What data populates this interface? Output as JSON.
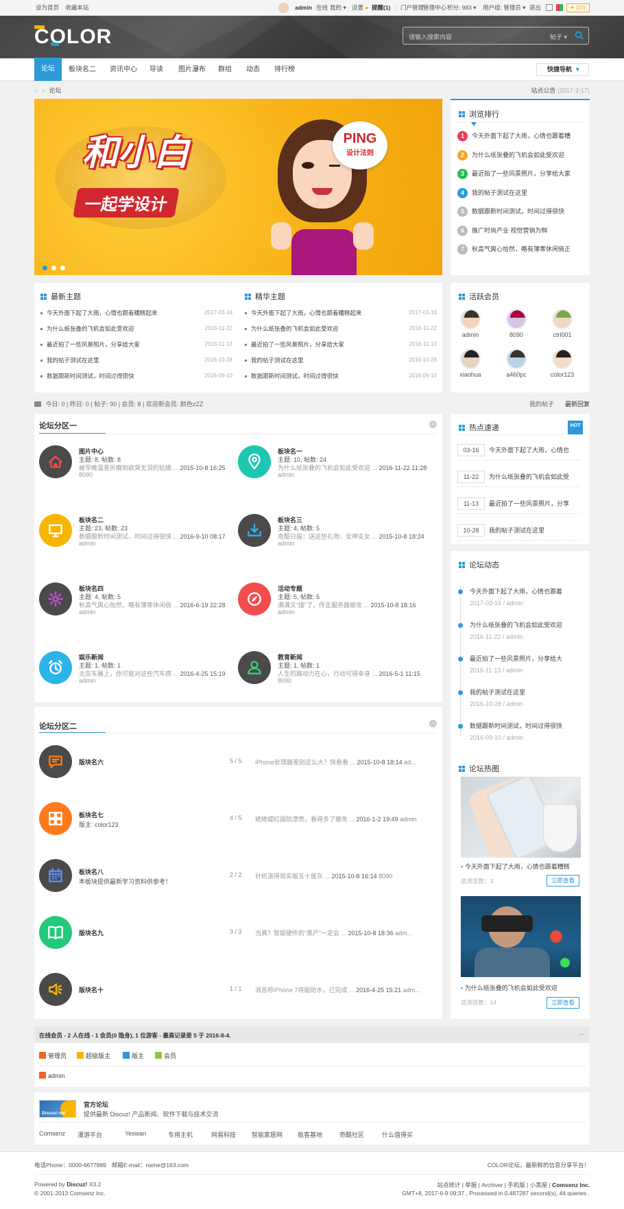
{
  "topbar": {
    "left_links": [
      "设为首页",
      "收藏本站"
    ],
    "username": "admin",
    "online": "在线",
    "items": [
      "我的",
      "设置"
    ],
    "remind": "提醒(1)",
    "right_items": [
      "门户管理",
      "管理中心",
      "积分: 983",
      "用户组: 管理员",
      "退出"
    ],
    "diy": "DIY"
  },
  "header": {
    "logo": "COLOR",
    "search_placeholder": "请输入搜索内容",
    "search_type": "帖子"
  },
  "nav": {
    "items": [
      "论坛",
      "板块名二",
      "资讯中心",
      "导读",
      "图片瀑布",
      "群组",
      "动态",
      "排行榜"
    ],
    "quick_nav": "快捷导航"
  },
  "breadcrumb": {
    "current": "论坛",
    "notice": "站点公告",
    "notice_date": "(2017-2-17)"
  },
  "banner": {
    "main_text": "和小白",
    "sub_text": "一起学设计",
    "bubble_title": "PING",
    "bubble_sub": "设计法则"
  },
  "browse_rank": {
    "title": "浏览排行",
    "items": [
      {
        "n": "1",
        "text": "今天外面下起了大雨，心情也跟着糟",
        "color": "#e83e5a"
      },
      {
        "n": "2",
        "text": "为什么纸张叠的飞机会如此受欢迎",
        "color": "#f5a623"
      },
      {
        "n": "3",
        "text": "最近拍了一些风景照片，分享给大家",
        "color": "#2dba5e"
      },
      {
        "n": "4",
        "text": "我的帖子测试在这里",
        "color": "#2c99d8"
      },
      {
        "n": "5",
        "text": "数据跟新时间测试，时间过得很快",
        "color": "#bbbbbb"
      },
      {
        "n": "6",
        "text": "推广时尚产业 视觉营销为鲜",
        "color": "#bbbbbb"
      },
      {
        "n": "7",
        "text": "秋高气爽心怡然，略有薄寒休闲倘正",
        "color": "#bbbbbb"
      }
    ]
  },
  "latest": {
    "title": "最新主题",
    "items": [
      {
        "text": "今天外面下起了大雨，心情也跟着糟糕起来",
        "date": "2017-03-16"
      },
      {
        "text": "为什么纸张叠的飞机会如此受欢迎",
        "date": "2016-11-22"
      },
      {
        "text": "最近拍了一些风景照片，分享给大家",
        "date": "2016-11-13"
      },
      {
        "text": "我的帖子测试在这里",
        "date": "2016-10-28"
      },
      {
        "text": "数据跟新时间测试，时间过得很快",
        "date": "2016-09-10"
      }
    ]
  },
  "digest": {
    "title": "精华主题",
    "items": [
      {
        "text": "今天外面下起了大雨，心情也跟着糟糕起来",
        "date": "2017-03-16"
      },
      {
        "text": "为什么纸张叠的飞机会如此受欢迎",
        "date": "2016-11-22"
      },
      {
        "text": "最近拍了一些风景照片，分享给大家",
        "date": "2016-11-13"
      },
      {
        "text": "我的帖子测试在这里",
        "date": "2016-10-28"
      },
      {
        "text": "数据跟新时间测试，时间过得很快",
        "date": "2016-09-10"
      }
    ]
  },
  "active_members": {
    "title": "活跃会员",
    "members": [
      "admin",
      "8090",
      "ctrl001",
      "xiaohua",
      "a460pc",
      "color123"
    ]
  },
  "stats": {
    "text": "今日: 0 | 昨日: 0 | 帖子: 90 | 会员: 8 | 欢迎新会员: 颜色zZZ",
    "my_posts": "我的帖子",
    "latest_reply": "最新回复"
  },
  "area1": {
    "title": "论坛分区一",
    "forums": [
      {
        "name": "图片中心",
        "stat": "主题: 8, 帖数: 8",
        "last": "被早晚温差折磨到欲哭无泪的姑娘 ...",
        "time": "2015-10-8 16:25",
        "author": "8090",
        "color": "#4a4a4a",
        "icon": "home"
      },
      {
        "name": "板块名一",
        "stat": "主题: 10, 帖数: 24",
        "last": "为什么纸张叠的飞机会如此受欢迎 ...",
        "time": "2016-11-22 11:28",
        "author": "admin",
        "color": "#1ec8b0",
        "icon": "pin"
      },
      {
        "name": "板块名二",
        "stat": "主题: 23, 帖数: 23",
        "last": "数据跟新时间测试，时间过得很快 ...",
        "time": "2016-9-10 08:17",
        "author": "admin",
        "color": "#f7b500",
        "icon": "monitor"
      },
      {
        "name": "板块名三",
        "stat": "主题: 4, 帖数: 5",
        "last": "奇酷日报：送这些礼物，女神支女 ...",
        "time": "2015-10-8 18:24",
        "author": "admin",
        "color": "#4a4a4a",
        "icon": "download"
      },
      {
        "name": "板块名四",
        "stat": "主题: 4, 帖数: 5",
        "last": "秋高气爽心怡然，略有薄寒休闲倘 ...",
        "time": "2016-6-19 22:28",
        "author": "admin",
        "color": "#4a4a4a",
        "icon": "gear"
      },
      {
        "name": "活动专题",
        "stat": "主题: 5, 帖数: 5",
        "last": "满满又“接”了，传言服务器被攻 ...",
        "time": "2015-10-8 18:16",
        "author": "admin",
        "color": "#f24c4c",
        "icon": "compass"
      },
      {
        "name": "娱乐新闻",
        "stat": "主题: 1, 帖数: 1",
        "last": "北京车展上，你可能对这些汽车感 ...",
        "time": "2016-4-25 15:19",
        "author": "admin",
        "color": "#2cb3e8",
        "icon": "alarm"
      },
      {
        "name": "教育新闻",
        "stat": "主题: 1, 帖数: 1",
        "last": "人生的路动力在心，行动可得幸身 ...",
        "time": "2016-5-1 11:15",
        "author": "8090",
        "color": "#4a4a4a",
        "icon": "user"
      }
    ]
  },
  "area2": {
    "title": "论坛分区二",
    "forums": [
      {
        "name": "版块名六",
        "desc": "",
        "count": "5 / 5",
        "last": "iPhone处理器差别这么大？快看看 ...",
        "time": "2015-10-8 18:14",
        "author": "ad...",
        "color": "#4a4a4a",
        "icon": "chat"
      },
      {
        "name": "板块名七",
        "desc": "版主: color123",
        "count": "4 / 5",
        "last": "姥姥蠕红国防漂亮，看得多了撤免 ...",
        "time": "2016-1-2 19:49",
        "author": "admin",
        "color": "#ff7a1a",
        "icon": "grid"
      },
      {
        "name": "板块名八",
        "desc": "本板块提供最新学习资料供参考！",
        "count": "2 / 2",
        "last": "针织滚得现实版五十度灰 ...",
        "time": "2015-10-8 16:14",
        "author": "8090",
        "color": "#4a4a4a",
        "icon": "calendar"
      },
      {
        "name": "版块名九",
        "desc": "",
        "count": "3 / 3",
        "last": "当真？智能硬件的“黑产”一定会 ...",
        "time": "2015-10-8 18:36",
        "author": "adm...",
        "color": "#22c97a",
        "icon": "book"
      },
      {
        "name": "版块名十",
        "desc": "",
        "count": "1 / 1",
        "last": "消息称iPhone 7将能防水，已完成 ...",
        "time": "2016-4-25 15:21",
        "author": "adm...",
        "color": "#4a4a4a",
        "icon": "speaker"
      }
    ]
  },
  "hot_tags": {
    "title": "热点速递",
    "badge": "HOT",
    "items": [
      {
        "date": "03-16",
        "text": "今天外面下起了大雨，心情也"
      },
      {
        "date": "11-22",
        "text": "为什么纸张叠的飞机会如此受"
      },
      {
        "date": "11-13",
        "text": "最近拍了一些风景照片，分享"
      },
      {
        "date": "10-28",
        "text": "我的帖子测试在这里"
      }
    ]
  },
  "forum_dynamic": {
    "title": "论坛动态",
    "items": [
      {
        "text": "今天外面下起了大雨，心情也跟着",
        "sub": "2017-03-16 / admin"
      },
      {
        "text": "为什么纸张叠的飞机会如此受欢迎",
        "sub": "2016-11-22 / admin"
      },
      {
        "text": "最近拍了一些风景照片，分享给大",
        "sub": "2016-11-13 / admin"
      },
      {
        "text": "我的帖子测试在这里",
        "sub": "2016-10-28 / admin"
      },
      {
        "text": "数据跟新时间测试，时间过得很快",
        "sub": "2016-09-10 / admin"
      }
    ]
  },
  "forum_hot": {
    "title": "论坛热图",
    "items": [
      {
        "caption": "今天外面下起了大雨，心情也跟着糟糕",
        "views": "总浏览数：3",
        "button": "立即查看"
      },
      {
        "caption": "为什么纸张叠的飞机会如此受欢迎",
        "views": "总浏览数：14",
        "button": "立即查看"
      }
    ]
  },
  "online": {
    "title": "在线会员 - 2 人在线 - 1 会员(0 隐身), 1 位游客 - 最高记录是 5 于 2016-8-4.",
    "legend": [
      "管理员",
      "超级版主",
      "版主",
      "会员"
    ],
    "legend_colors": [
      "#f26522",
      "#f7b500",
      "#2c99d8",
      "#8cc63f"
    ],
    "user": "admin"
  },
  "friend_link": {
    "logo_text": "Discuz! net",
    "name": "官方论坛",
    "desc": "提供最新 Discuz! 产品新闻、软件下载与技术交流",
    "links": [
      "Comsenz",
      "漫游平台",
      "Yeswan",
      "专用主机",
      "网易科技",
      "智能家居网",
      "极客基地",
      "奇酷社区",
      "什么值得买"
    ]
  },
  "footer": {
    "phone": "电话Phone：0000-6677889",
    "email": "邮箱E-mail：name@163.com",
    "slogan": "COLOR论坛，最新鲜的信息分享平台！",
    "powered": "Powered by",
    "discuz": "Discuz!",
    "version": "X3.2",
    "copyright": "© 2001-2013 Comsenz Inc.",
    "links": "站点统计 | 举报 | Archiver | 手机版 | 小黑屋 |",
    "company": "Comsenz Inc.",
    "runtime": "GMT+8, 2017-6-9 09:37 , Processed in 0.487287 second(s), 44 queries ."
  }
}
